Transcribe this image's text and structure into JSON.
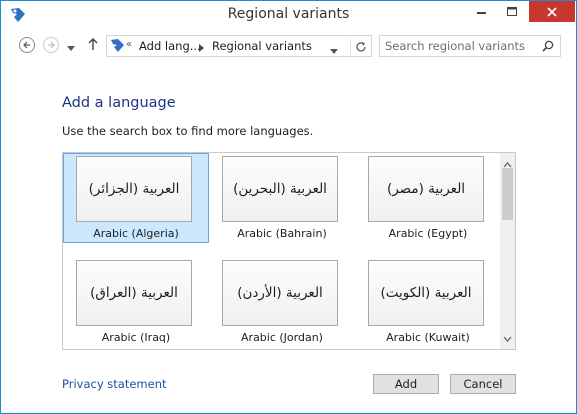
{
  "window": {
    "title": "Regional variants"
  },
  "nav": {
    "breadcrumb_overflow": "«",
    "crumb_1": "Add lang...",
    "crumb_2": "Regional variants",
    "search_placeholder": "Search regional variants"
  },
  "main": {
    "heading": "Add a language",
    "subtitle": "Use the search box to find more languages.",
    "languages": [
      {
        "native": "العربية (الجزائر)",
        "label": "Arabic (Algeria)",
        "selected": true
      },
      {
        "native": "العربية (البحرين)",
        "label": "Arabic (Bahrain)"
      },
      {
        "native": "العربية (مصر)",
        "label": "Arabic (Egypt)"
      },
      {
        "native": "العربية (العراق)",
        "label": "Arabic (Iraq)"
      },
      {
        "native": "العربية (الأردن)",
        "label": "Arabic (Jordan)"
      },
      {
        "native": "العربية (الكويت)",
        "label": "Arabic (Kuwait)"
      }
    ]
  },
  "footer": {
    "privacy_link": "Privacy statement",
    "add_label": "Add",
    "cancel_label": "Cancel"
  },
  "colors": {
    "accent": "#1f8ad2",
    "close": "#c7372f",
    "selection": "#cce8ff",
    "heading": "#1e3287",
    "link": "#1e50a2"
  }
}
